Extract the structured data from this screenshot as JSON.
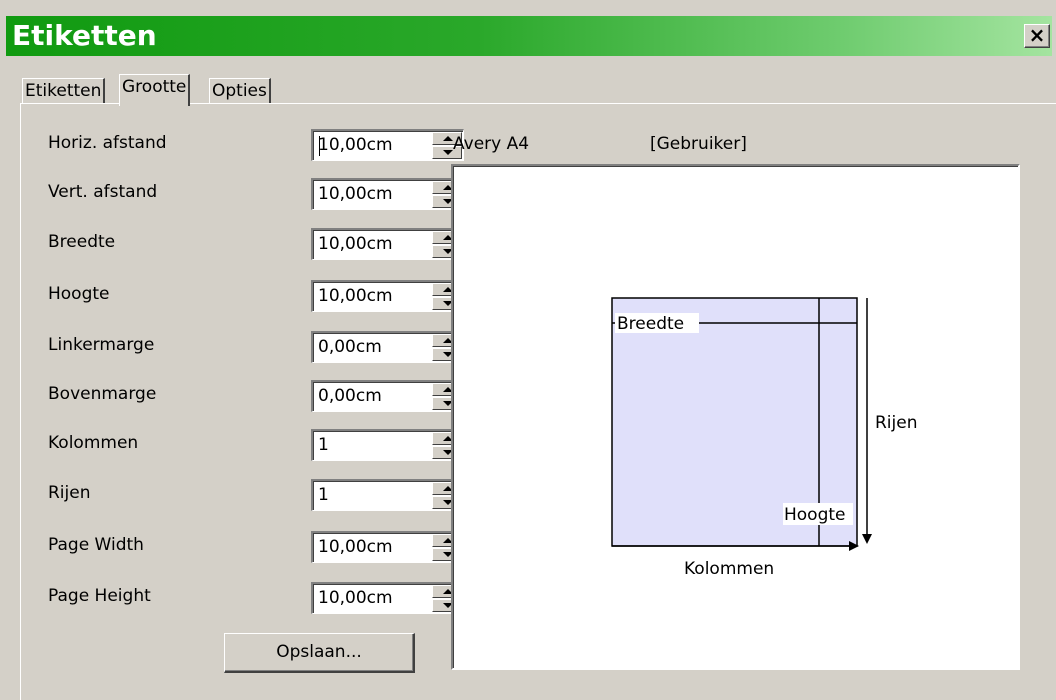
{
  "window": {
    "title": "Etiketten",
    "close_label": "×"
  },
  "tabs": [
    {
      "label": "Etiketten"
    },
    {
      "label": "Grootte"
    },
    {
      "label": "Opties"
    }
  ],
  "fields": [
    {
      "label": "Horiz. afstand",
      "value": "10,00cm"
    },
    {
      "label": "Vert. afstand",
      "value": "10,00cm"
    },
    {
      "label": "Breedte",
      "value": "10,00cm"
    },
    {
      "label": "Hoogte",
      "value": "10,00cm"
    },
    {
      "label": "Linkermarge",
      "value": "0,00cm"
    },
    {
      "label": "Bovenmarge",
      "value": "0,00cm"
    },
    {
      "label": "Kolommen",
      "value": "1"
    },
    {
      "label": "Rijen",
      "value": "1"
    },
    {
      "label": "Page Width",
      "value": "10,00cm"
    },
    {
      "label": "Page Height",
      "value": "10,00cm"
    }
  ],
  "save_label": "Opslaan...",
  "preview": {
    "brand": "Avery A4",
    "type": "[Gebruiker]",
    "label_width": "Breedte",
    "label_height": "Hoogte",
    "rows": "Rijen",
    "columns": "Kolommen",
    "label_color": "#e0e0fa"
  }
}
